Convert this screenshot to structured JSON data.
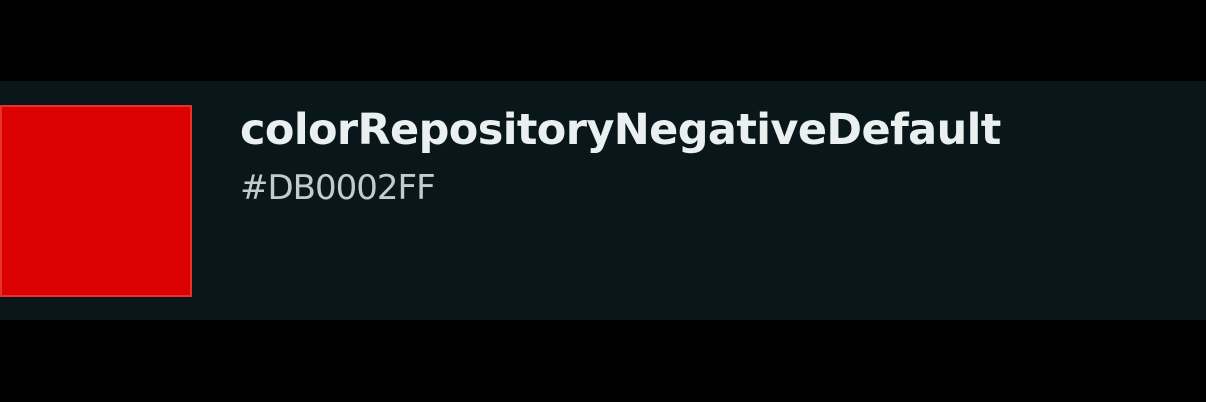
{
  "token": {
    "name": "colorRepositoryNegativeDefault",
    "value": "#DB0002FF",
    "swatch_color": "#DB0002",
    "swatch_border_color": "#E8302E"
  },
  "colors": {
    "page_background": "#000000",
    "card_background": "#09171A",
    "name_text": "#EAEFF0",
    "value_text": "#C4CBCE"
  }
}
